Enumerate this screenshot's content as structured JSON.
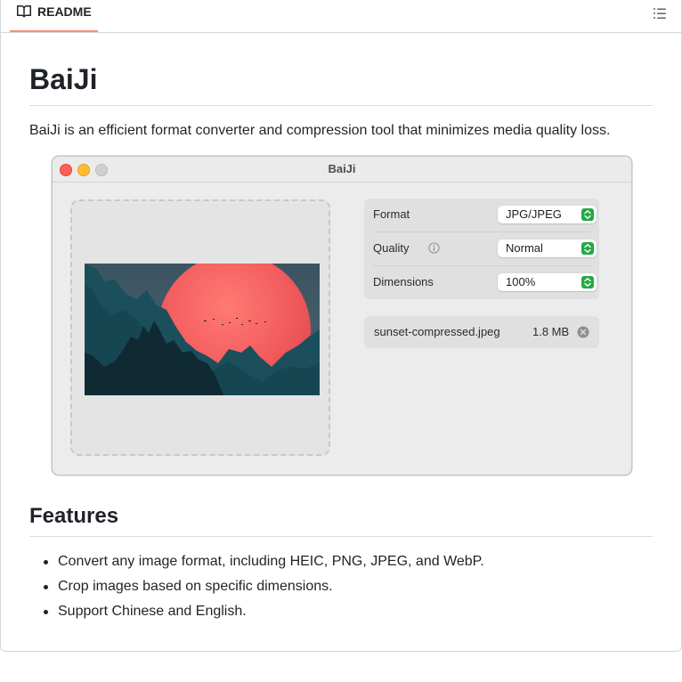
{
  "header": {
    "tab_label": "README",
    "tab_icon": "book-icon",
    "outline_icon": "list-unordered-icon",
    "tab_underline_color": "#fd8c73"
  },
  "readme": {
    "title": "BaiJi",
    "intro": "BaiJi is an efficient format converter and compression tool that minimizes media quality loss.",
    "features_heading": "Features",
    "features": [
      "Convert any image format, including HEIC, PNG, JPEG, and WebP.",
      "Crop images based on specific dimensions.",
      "Support Chinese and English."
    ]
  },
  "app_screenshot": {
    "window_title": "BaiJi",
    "traffic_lights": {
      "close": "#fe5f57",
      "minimize": "#febc2e",
      "maximize": "#d0d0d0"
    },
    "settings": [
      {
        "label": "Format",
        "value": "JPG/JPEG",
        "info_icon": false
      },
      {
        "label": "Quality",
        "value": "Normal",
        "info_icon": true
      },
      {
        "label": "Dimensions",
        "value": "100%",
        "info_icon": false
      }
    ],
    "popup_accent": "#28a745",
    "file": {
      "name": "sunset-compressed.jpeg",
      "size": "1.8 MB",
      "remove_icon": "close-circle-icon"
    },
    "preview": {
      "description_icon": "sunset-mountain-image",
      "sun_color": "#f35a5a",
      "mountain_color": "#1a4d5a",
      "sky_color": "#3f5663"
    }
  }
}
